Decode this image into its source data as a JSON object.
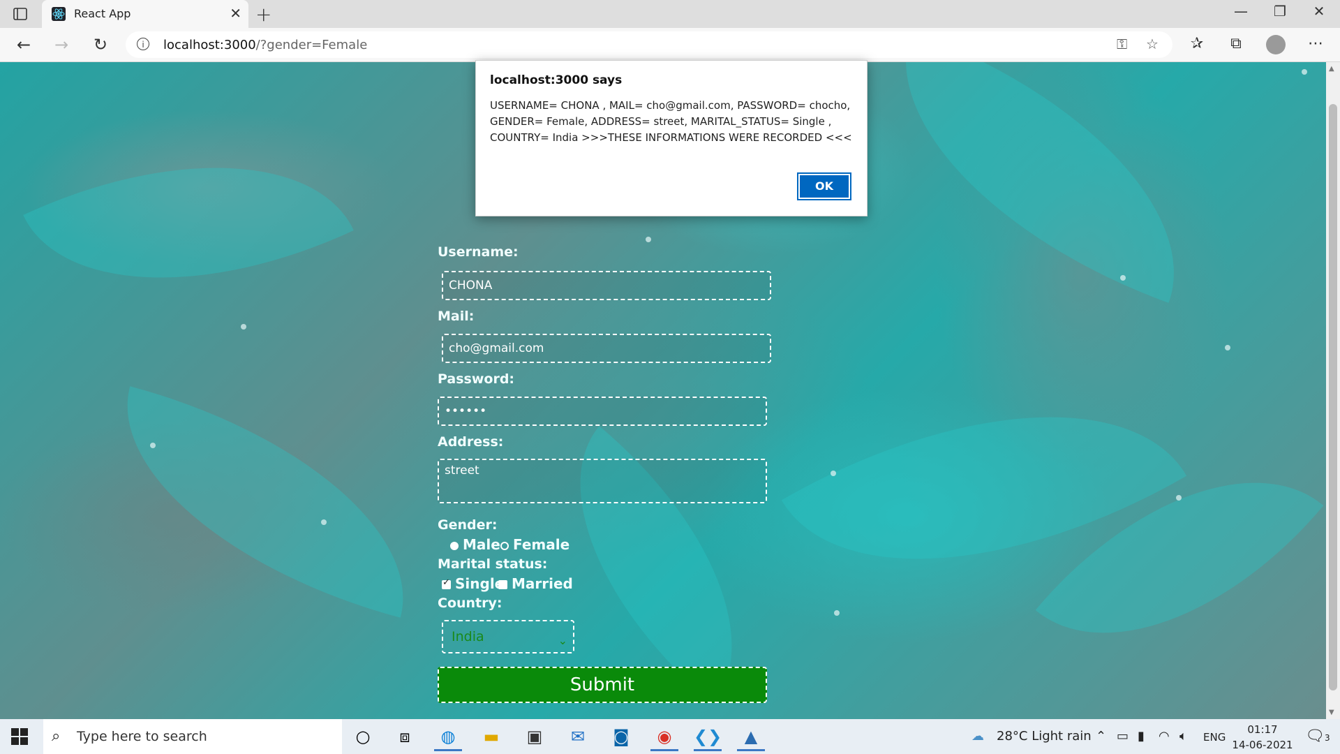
{
  "browser": {
    "tab_title": "React App",
    "url_host": "localhost:3000",
    "url_path": "/?gender=Female"
  },
  "form": {
    "username_label": "Username:",
    "username_value": "CHONA",
    "mail_label": "Mail:",
    "mail_value": "cho@gmail.com",
    "password_label": "Password:",
    "password_value": "••••••",
    "address_label": "Address:",
    "address_value": "street",
    "gender_label": "Gender:",
    "gender_options": [
      "Male",
      "Female"
    ],
    "gender_selected": "Female",
    "marital_label": "Marital status:",
    "marital_options": [
      "Single",
      "Married"
    ],
    "marital_checked": [
      "Single"
    ],
    "country_label": "Country:",
    "country_value": "India",
    "submit_label": "Submit"
  },
  "dialog": {
    "title": "localhost:3000 says",
    "message": "USERNAME= CHONA  , MAIL= cho@gmail.com, PASSWORD= chocho, GENDER=  Female, ADDRESS= street, MARITAL_STATUS= Single , COUNTRY= India >>>THESE INFORMATIONS WERE RECORDED <<<",
    "ok_label": "OK"
  },
  "taskbar": {
    "search_placeholder": "Type here to search",
    "weather": "28°C  Light rain",
    "language": "ENG",
    "time": "01:17",
    "date": "14-06-2021",
    "notification_count": "3"
  },
  "colors": {
    "accent": "#0067c0",
    "submit_bg": "#0a8a0a",
    "page_teal": "#2a9c9c"
  }
}
